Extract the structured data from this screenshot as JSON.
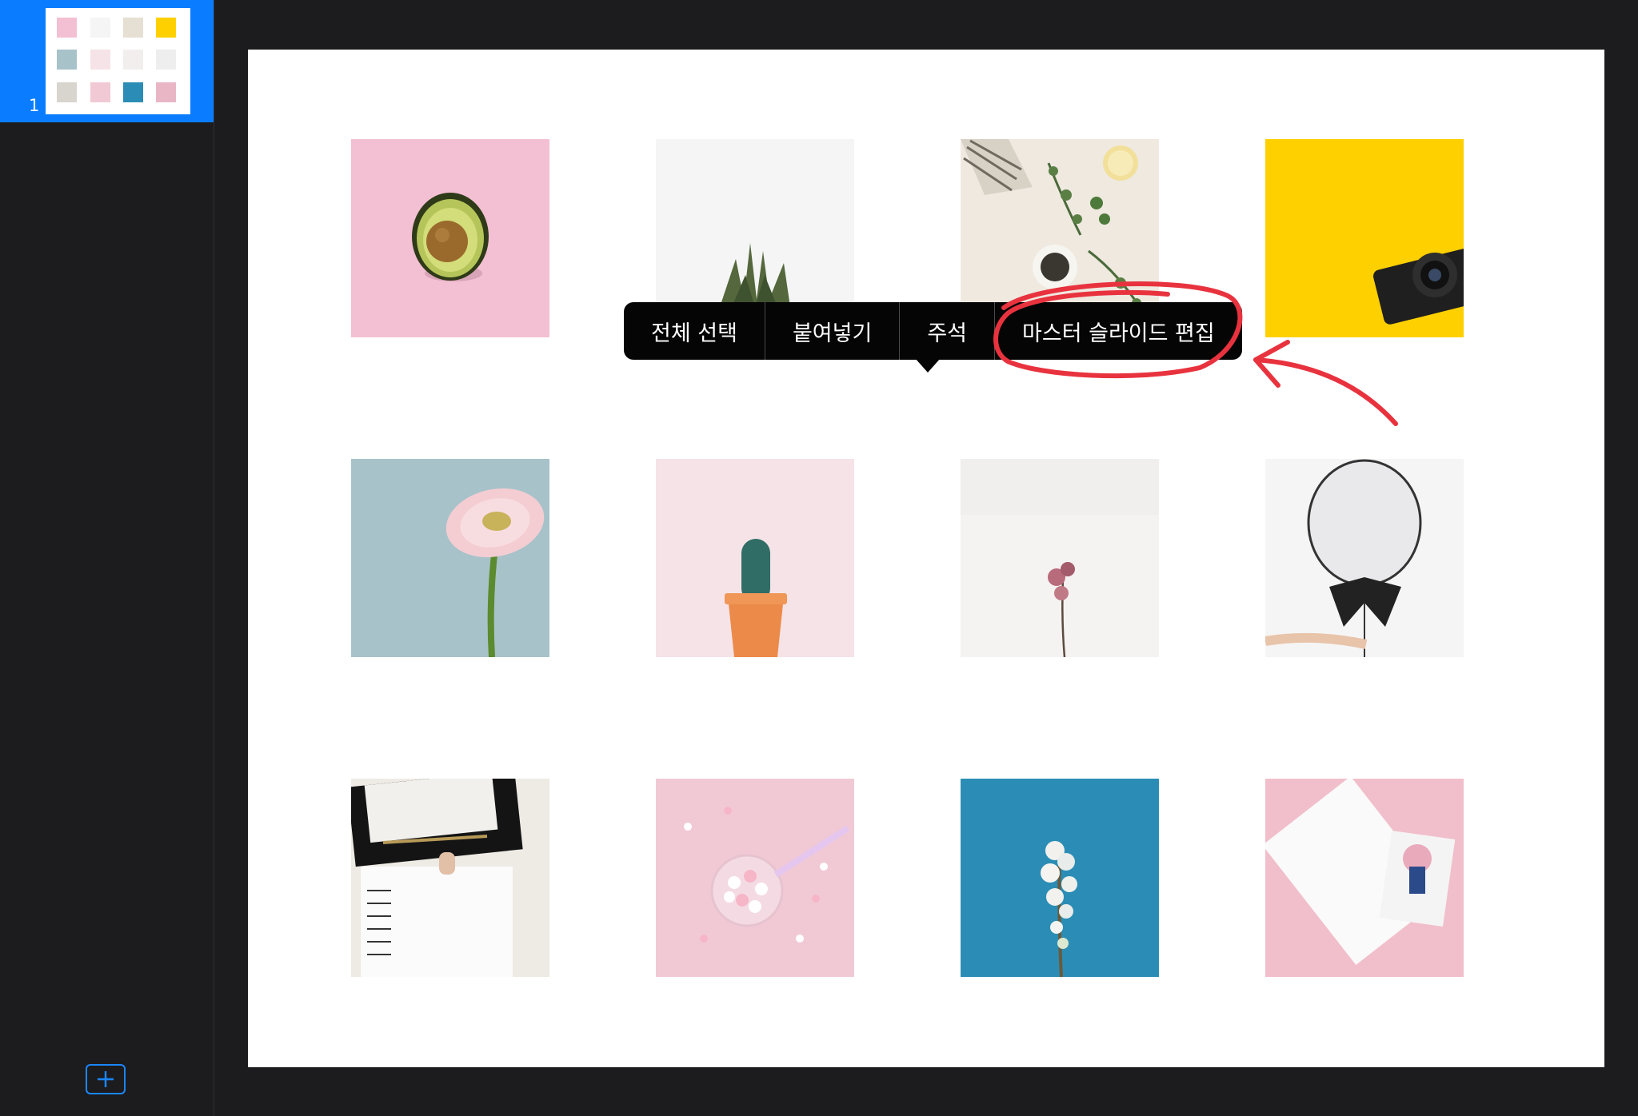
{
  "sidebar": {
    "slide_number": "1",
    "add_slide_icon": "plus-icon",
    "accent": "#0a7cff"
  },
  "slide": {
    "photos": [
      {
        "name": "avocado",
        "bg": "#f3bfd3"
      },
      {
        "name": "pineapple",
        "bg": "#f4f5f4"
      },
      {
        "name": "herbs",
        "bg": "#efe9e0"
      },
      {
        "name": "camera",
        "bg": "#ffd000"
      },
      {
        "name": "gerbera",
        "bg": "#a7c2c9"
      },
      {
        "name": "cactus",
        "bg": "#f5e3e7"
      },
      {
        "name": "dried-rose",
        "bg": "#f5f2f2"
      },
      {
        "name": "balloon",
        "bg": "#f5f5f5"
      },
      {
        "name": "clipboard",
        "bg": "#eeeae4"
      },
      {
        "name": "marshmallows",
        "bg": "#f1c9d5"
      },
      {
        "name": "blossom",
        "bg": "#2b8db5"
      },
      {
        "name": "sketchbook",
        "bg": "#f1bfcb"
      }
    ]
  },
  "context_menu": {
    "items": [
      "전체 선택",
      "붙여넣기",
      "주석",
      "마스터 슬라이드 편집"
    ]
  },
  "annotation": {
    "color": "#e8333f"
  }
}
